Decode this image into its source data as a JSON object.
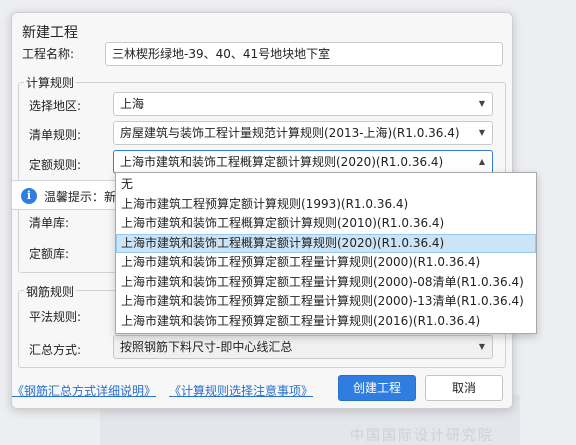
{
  "dialog": {
    "title": "新建工程",
    "project_name_label": "工程名称:",
    "project_name_value": "三林楔形绿地-39、40、41号地块地下室",
    "calc_rules": {
      "legend": "计算规则",
      "region_label": "选择地区:",
      "region_value": "上海",
      "bill_rule_label": "清单规则:",
      "bill_rule_value": "房屋建筑与装饰工程计量规范计算规则(2013-上海)(R1.0.36.4)",
      "quota_rule_label": "定额规则:",
      "quota_rule_value": "上海市建筑和装饰工程概算定额计算规则(2020)(R1.0.36.4)",
      "bill_lib_label": "清单库:",
      "quota_lib_label": "定额库:"
    },
    "tip": {
      "text": "温馨提示：新",
      "icon": "info-icon"
    },
    "rebar_rules": {
      "legend": "钢筋规则",
      "flat_rule_label": "平法规则:",
      "summary_label": "汇总方式:",
      "summary_value": "按照钢筋下料尺寸-即中心线汇总"
    },
    "links": {
      "rebar_summary_help": "《钢筋汇总方式详细说明》",
      "calc_rule_notes": "《计算规则选择注意事项》"
    },
    "buttons": {
      "create": "创建工程",
      "cancel": "取消"
    },
    "dropdown": {
      "selected_index": 3,
      "options": [
        "无",
        "上海市建筑工程预算定额计算规则(1993)(R1.0.36.4)",
        "上海市建筑和装饰工程概算定额计算规则(2010)(R1.0.36.4)",
        "上海市建筑和装饰工程概算定额计算规则(2020)(R1.0.36.4)",
        "上海市建筑和装饰工程预算定额工程量计算规则(2000)(R1.0.36.4)",
        "上海市建筑和装饰工程预算定额工程量计算规则(2000)-08清单(R1.0.36.4)",
        "上海市建筑和装饰工程预算定额工程量计算规则(2000)-13清单(R1.0.36.4)",
        "上海市建筑和装饰工程预算定额工程量计算规则(2016)(R1.0.36.4)"
      ]
    }
  },
  "background": {
    "watermark_text": "中国国际设计研究院"
  },
  "colors": {
    "accent": "#2f7de1",
    "selected_row": "#cce4f7",
    "link": "#2a6fcb"
  }
}
